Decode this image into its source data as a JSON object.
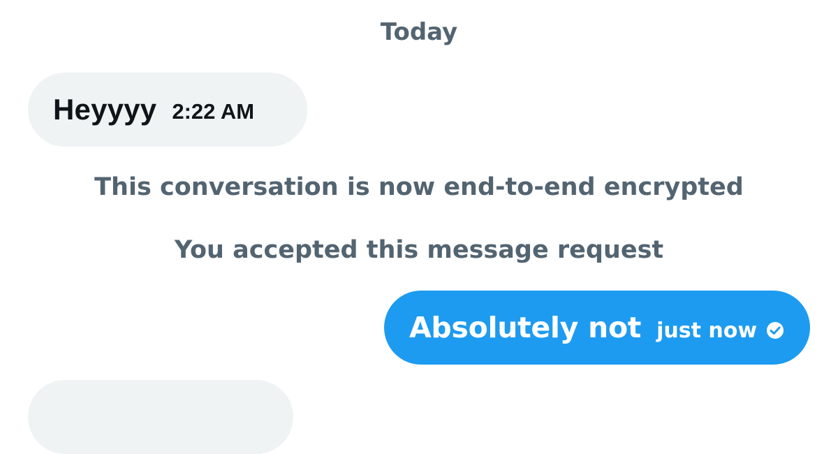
{
  "conversation": {
    "day_separator": "Today",
    "messages": [
      {
        "direction": "received",
        "text": "Heyyyy",
        "time": "2:22 AM"
      },
      {
        "direction": "sent",
        "text": "Absolutely not",
        "time": "just now",
        "status_icon": "check-circle-icon"
      }
    ],
    "notices": {
      "encrypted": "This conversation is now end-to-end encrypted",
      "accepted": "You accepted this message request"
    }
  },
  "colors": {
    "received_bubble": "#eff3f4",
    "sent_bubble": "#1d9bf0",
    "secondary_text": "#536471",
    "primary_text": "#0f1419"
  }
}
